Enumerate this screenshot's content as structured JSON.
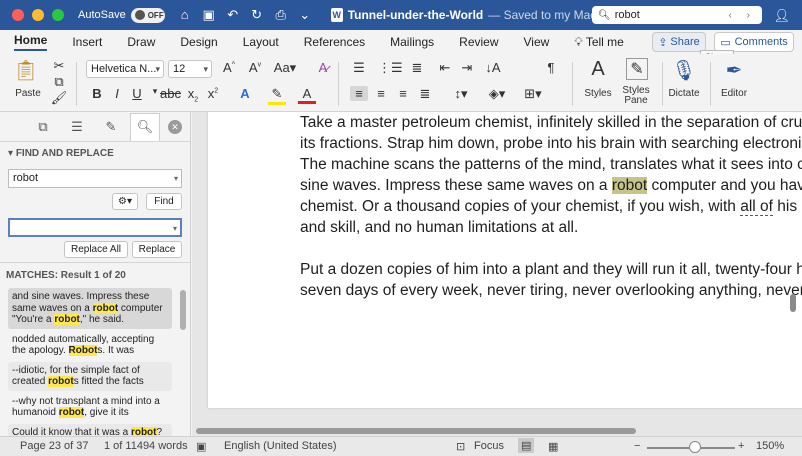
{
  "titlebar": {
    "autosave_label": "AutoSave",
    "autosave_state": "OFF",
    "doc_name": "Tunnel-under-the-World",
    "saved_status": "— Saved to my Mac",
    "search_query": "robot"
  },
  "tabs": [
    "Home",
    "Insert",
    "Draw",
    "Design",
    "Layout",
    "References",
    "Mailings",
    "Review",
    "View"
  ],
  "tell_me": "Tell me",
  "share_label": "Share",
  "comments_label": "Comments",
  "tooltip": "Share",
  "ribbon": {
    "paste_label": "Paste",
    "font_name": "Helvetica N...",
    "font_size": "12",
    "styles_label": "Styles",
    "styles_pane_label": "Styles Pane",
    "dictate_label": "Dictate",
    "editor_label": "Editor"
  },
  "sidebar": {
    "header": "FIND AND REPLACE",
    "search_value": "robot",
    "find_label": "Find",
    "replace_value": "",
    "replace_all_label": "Replace All",
    "replace_label": "Replace",
    "matches_label": "MATCHES: Result 1 of 20",
    "results": [
      {
        "before": "and sine waves. Impress these same waves on a ",
        "match": "robot",
        "after": " computer \"You're a ",
        "match2": "robot",
        "after2": ",\" he said."
      },
      {
        "before": "nodded automatically, accepting the apology. ",
        "match": "Robot",
        "after": "s. It was"
      },
      {
        "before": "--idiotic, for the simple fact of created ",
        "match": "robot",
        "after": "s fitted the facts"
      },
      {
        "before": "--why not transplant a mind into a humanoid ",
        "match": "robot",
        "after": ", give it its"
      },
      {
        "before": "Could it know that it was a ",
        "match": "robot",
        "after": "?"
      }
    ]
  },
  "document": {
    "para1": [
      "Take a master petroleum chemist, infinitely skilled in the separation of crude",
      "its fractions. Strap him down, probe into his brain with searching electronic",
      "The machine scans the patterns of the mind, translates what it sees into ch"
    ],
    "line4_before": "sine waves. Impress these same waves on a ",
    "line4_match": "robot",
    "line4_after": " computer and you have",
    "line5_before": "chemist. Or a thousand copies of your chemist, if you wish, with ",
    "line5_squig": "all of",
    "line5_after": " his k",
    "line6": "and skill, and no human limitations at all.",
    "para2": [
      "Put a dozen copies of him into a plant and they will run it all, twenty-four h",
      "seven days of every week, never tiring, never overlooking anything, never f"
    ]
  },
  "status": {
    "page": "Page 23 of 37",
    "words": "1 of 11494 words",
    "language": "English (United States)",
    "focus": "Focus",
    "zoom": "150%",
    "zoom_level": 0.55
  },
  "colors": {
    "brand": "#2b579a",
    "doc_highlight": "#c7c48a",
    "result_highlight": "#ffe84d"
  }
}
